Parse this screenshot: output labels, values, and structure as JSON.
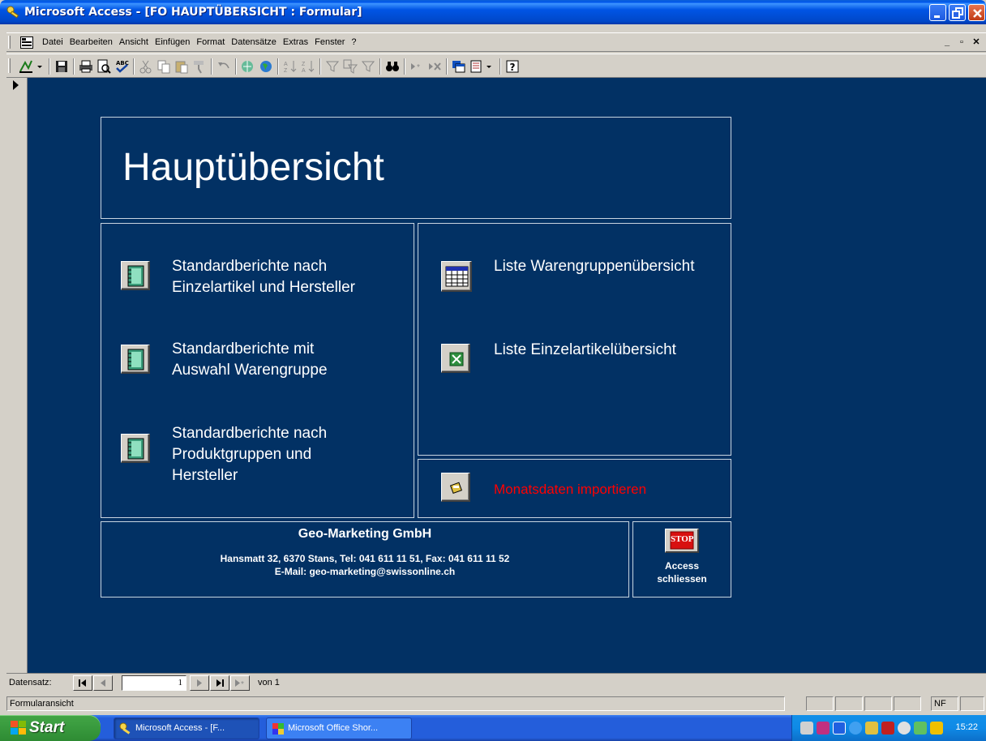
{
  "window": {
    "title": "Microsoft Access - [FO HAUPTÜBERSICHT : Formular]"
  },
  "menu": {
    "items": [
      "Datei",
      "Bearbeiten",
      "Ansicht",
      "Einfügen",
      "Format",
      "Datensätze",
      "Extras",
      "Fenster",
      "?"
    ]
  },
  "form": {
    "title": "Hauptübersicht",
    "left_buttons": [
      {
        "label": "Standardberichte nach Einzelartikel und Hersteller",
        "icon": "report-notebook-icon"
      },
      {
        "label": "Standardberichte mit Auswahl Warengruppe",
        "icon": "report-notebook-icon"
      },
      {
        "label": "Standardberichte nach Produktgruppen und Hersteller",
        "icon": "report-notebook-icon"
      }
    ],
    "right_buttons": [
      {
        "label": "Liste Warengruppenübersicht",
        "icon": "datasheet-icon"
      },
      {
        "label": "Liste Einzelartikelübersicht",
        "icon": "excel-icon"
      }
    ],
    "import_button": {
      "label": "Monatsdaten importieren",
      "icon": "import-icon",
      "color": "#ff0000"
    },
    "footer": {
      "company": "Geo-Marketing GmbH",
      "address": "Hansmatt 32, 6370 Stans, Tel: 041 611 11 51, Fax: 041 611 11 52",
      "email": "E-Mail: geo-marketing@swissonline.ch"
    },
    "close_button": {
      "icon_text": "STOP",
      "label_line1": "Access",
      "label_line2": "schliessen"
    },
    "background_color": "#023164"
  },
  "navigation": {
    "label": "Datensatz:",
    "current": "1",
    "of_label": "von 1"
  },
  "status": {
    "view": "Formularansicht",
    "indicator": "NF"
  },
  "taskbar": {
    "start": "Start",
    "tasks": [
      "Microsoft Access - [F...",
      "Microsoft Office Shor..."
    ],
    "clock": "15:22"
  }
}
